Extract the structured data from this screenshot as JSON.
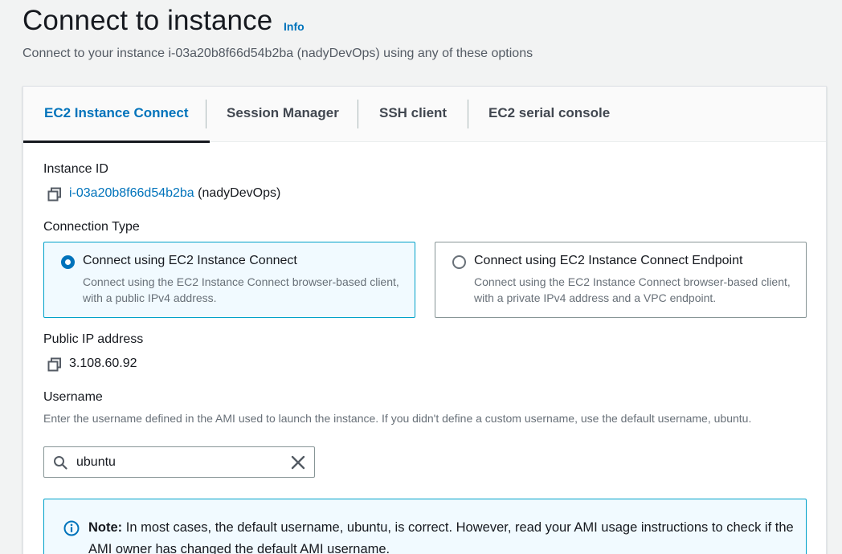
{
  "header": {
    "title": "Connect to instance",
    "info_label": "Info",
    "subtitle": "Connect to your instance i-03a20b8f66d54b2ba (nadyDevOps) using any of these options"
  },
  "tabs": [
    {
      "label": "EC2 Instance Connect",
      "active": true
    },
    {
      "label": "Session Manager",
      "active": false
    },
    {
      "label": "SSH client",
      "active": false
    },
    {
      "label": "EC2 serial console",
      "active": false
    }
  ],
  "instance": {
    "label": "Instance ID",
    "id": "i-03a20b8f66d54b2ba",
    "name": "(nadyDevOps)"
  },
  "connection_type": {
    "label": "Connection Type",
    "options": [
      {
        "title": "Connect using EC2 Instance Connect",
        "description": "Connect using the EC2 Instance Connect browser-based client, with a public IPv4 address.",
        "selected": true
      },
      {
        "title": "Connect using EC2 Instance Connect Endpoint",
        "description": "Connect using the EC2 Instance Connect browser-based client, with a private IPv4 address and a VPC endpoint.",
        "selected": false
      }
    ]
  },
  "public_ip": {
    "label": "Public IP address",
    "value": "3.108.60.92"
  },
  "username": {
    "label": "Username",
    "help": "Enter the username defined in the AMI used to launch the instance. If you didn't define a custom username, use the default username, ubuntu.",
    "value": "ubuntu"
  },
  "note": {
    "prefix": "Note:",
    "text": " In most cases, the default username, ubuntu, is correct. However, read your AMI usage instructions to check if the AMI owner has changed the default AMI username."
  },
  "colors": {
    "accent": "#0073bb",
    "selected_border": "#00a1c9",
    "selected_bg": "#f1faff"
  },
  "icons": {
    "copy": "copy-icon",
    "search": "search-icon",
    "clear": "close-icon",
    "info": "info-circle-icon"
  }
}
